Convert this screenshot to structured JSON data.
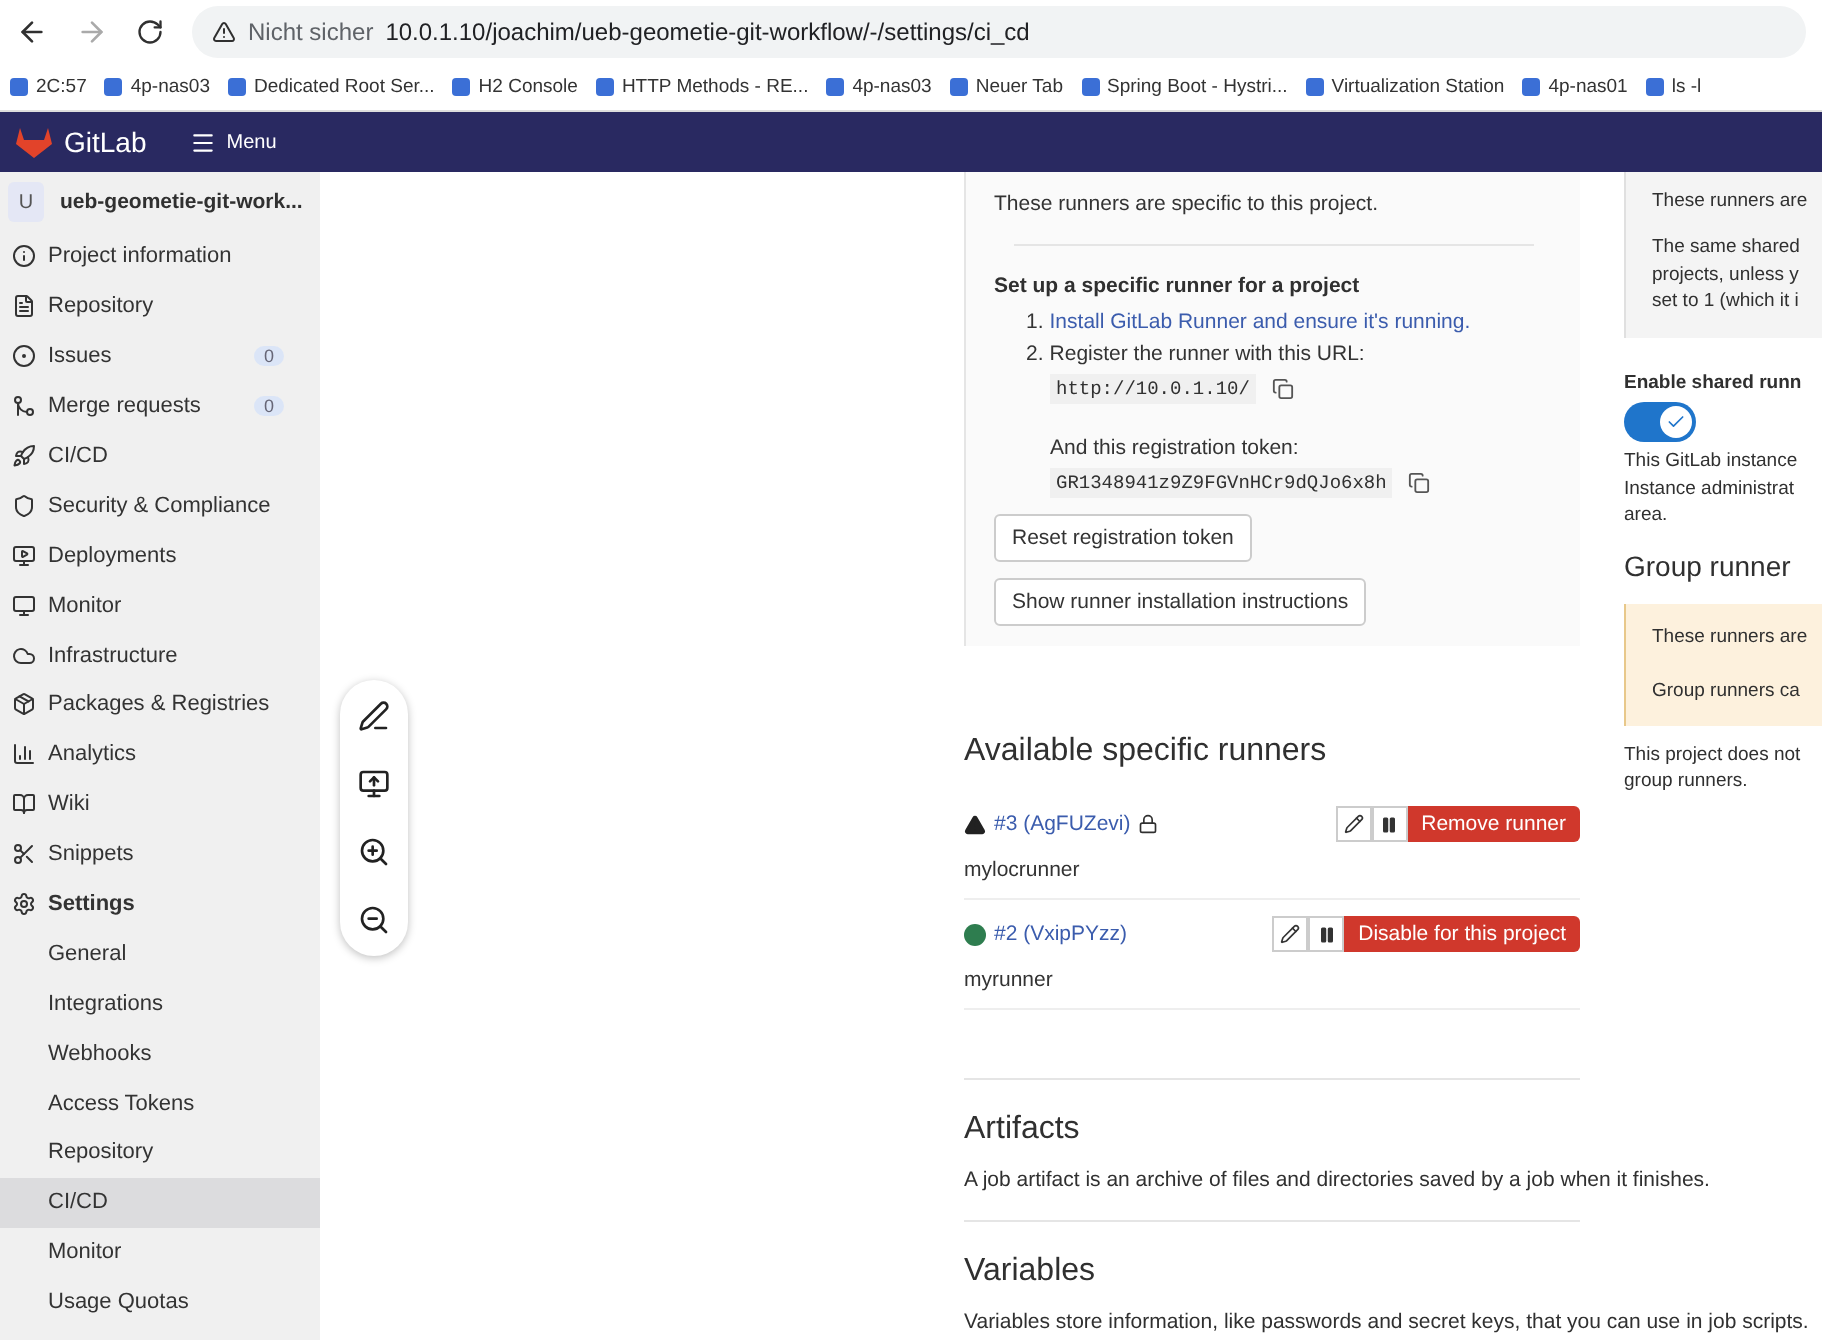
{
  "browser": {
    "security": "Nicht sicher",
    "url": "10.0.1.10/joachim/ueb-geometie-git-workflow/-/settings/ci_cd",
    "bookmarks": [
      "2C:57",
      "4p-nas03",
      "Dedicated Root Ser...",
      "H2 Console",
      "HTTP Methods - RE...",
      "4p-nas03",
      "Neuer Tab",
      "Spring Boot - Hystri...",
      "Virtualization Station",
      "4p-nas01",
      "ls -l"
    ]
  },
  "header": {
    "brand": "GitLab",
    "menu": "Menu"
  },
  "sidebar": {
    "project_initial": "U",
    "project_name": "ueb-geometie-git-work...",
    "items": [
      {
        "label": "Project information"
      },
      {
        "label": "Repository"
      },
      {
        "label": "Issues",
        "count": "0"
      },
      {
        "label": "Merge requests",
        "count": "0"
      },
      {
        "label": "CI/CD"
      },
      {
        "label": "Security & Compliance"
      },
      {
        "label": "Deployments"
      },
      {
        "label": "Monitor"
      },
      {
        "label": "Infrastructure"
      },
      {
        "label": "Packages & Registries"
      },
      {
        "label": "Analytics"
      },
      {
        "label": "Wiki"
      },
      {
        "label": "Snippets"
      },
      {
        "label": "Settings",
        "expanded": true,
        "children": [
          {
            "label": "General",
            "selected": false
          },
          {
            "label": "Integrations",
            "selected": false
          },
          {
            "label": "Webhooks",
            "selected": false
          },
          {
            "label": "Access Tokens",
            "selected": false
          },
          {
            "label": "Repository",
            "selected": false
          },
          {
            "label": "CI/CD",
            "selected": true
          },
          {
            "label": "Monitor",
            "selected": false
          },
          {
            "label": "Usage Quotas",
            "selected": false
          }
        ]
      }
    ]
  },
  "specific_panel": {
    "intro": "These runners are specific to this project.",
    "setup_title": "Set up a specific runner for a project",
    "steps": [
      {
        "number": "1.",
        "text": "Install GitLab Runner and ensure it's running.",
        "kind": "link"
      },
      {
        "number": "2.",
        "text": "Register the runner with this URL:",
        "kind": "text"
      }
    ],
    "url": "http://10.0.1.10/",
    "token_label": "And this registration token:",
    "token": "GR1348941z9Z9FGVnHCr9dQJo6x8h",
    "buttons": [
      "Reset registration token",
      "Show runner installation instructions"
    ]
  },
  "available_runners": {
    "title": "Available specific runners",
    "runners": [
      {
        "id": "#3 (AgFUZevi)",
        "kind": "warning",
        "locked": true,
        "name": "mylocrunner",
        "action": "Remove runner"
      },
      {
        "id": "#2 (VxipPYzz)",
        "kind": "online",
        "color": "#2e7d4f",
        "locked": false,
        "name": "myrunner",
        "action": "Disable for this project"
      }
    ]
  },
  "artifacts": {
    "title": "Artifacts",
    "description": "A job artifact is an archive of files and directories saved by a job when it finishes."
  },
  "variables": {
    "title": "Variables",
    "description": "Variables store information, like passwords and secret keys, that you can use in job scripts."
  },
  "shared_column": {
    "info_lines": [
      "These runners are"
    ],
    "info_paragraph": [
      "The same shared",
      "projects, unless y",
      "set to 1 (which it i"
    ],
    "toggle_label": "Enable shared runn",
    "toggle_on": true,
    "note_lines": [
      "This GitLab instance",
      "Instance administrat",
      "area."
    ],
    "group_title": "Group runner",
    "group_box_lines": [
      "These runners are",
      "Group runners ca"
    ],
    "group_note_lines": [
      "This project does not",
      "group runners."
    ]
  }
}
